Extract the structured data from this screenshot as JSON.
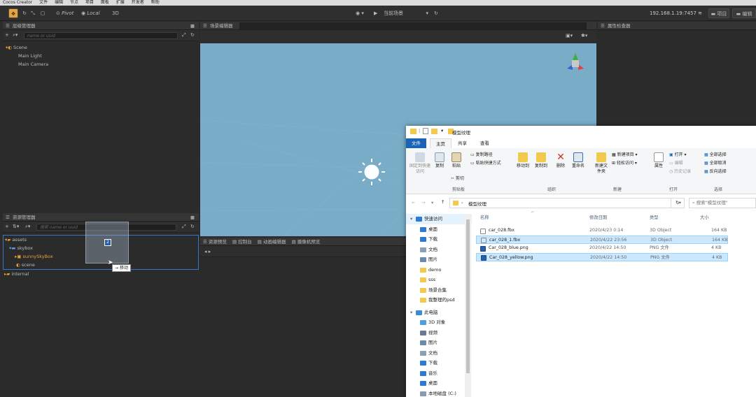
{
  "app": {
    "title": "Cocos Creator",
    "menu": [
      "文件",
      "编辑",
      "节点",
      "项目",
      "面板",
      "扩展",
      "开发者",
      "帮助"
    ]
  },
  "toolbar": {
    "pivot_label": "Pivot",
    "local_label": "Local",
    "mode_3d": "3D",
    "scene_select": "当前场景",
    "ip": "192.168.1.19:7457",
    "project_btn": "项目",
    "editor_btn": "编辑"
  },
  "hierarchy": {
    "title": "层级管理器",
    "search_placeholder": "name or uuid",
    "nodes": [
      "Scene",
      "Main Light",
      "Main Camera"
    ]
  },
  "scene_editor": {
    "title": "场景编辑器"
  },
  "inspector": {
    "title": "属性检查器"
  },
  "assets": {
    "title": "资源管理器",
    "search_placeholder": "搜索 name or uuid",
    "items": [
      "assets",
      "skybox",
      "sunnySkyBox",
      "scene",
      "internal"
    ],
    "drag_count": "2",
    "drag_tooltip": "移动"
  },
  "bottom_tabs": [
    "资源预览",
    "控制台",
    "动画编辑器",
    "摄像机预览"
  ],
  "explorer": {
    "title": "模型纹理",
    "ribbon_tabs": [
      "文件",
      "主页",
      "共享",
      "查看"
    ],
    "clipboard": {
      "pin": "固定到快速访问",
      "copy": "复制",
      "paste": "粘贴",
      "copy_path": "复制路径",
      "paste_shortcut": "粘贴快捷方式",
      "cut": "剪切",
      "group": "剪贴板"
    },
    "organize": {
      "move_to": "移动到",
      "copy_to": "复制到",
      "delete": "删除",
      "rename": "重命名",
      "group": "组织"
    },
    "new": {
      "new_folder": "新建文件夹",
      "new_item": "新建项目",
      "easy_access": "轻松访问",
      "group": "新建"
    },
    "open": {
      "properties": "属性",
      "open": "打开",
      "edit": "编辑",
      "history": "历史记录",
      "group": "打开"
    },
    "select": {
      "select_all": "全部选择",
      "select_none": "全部取消",
      "invert": "反向选择",
      "group": "选择"
    },
    "address": "模型纹理",
    "search_placeholder": "搜索\"模型纹理\"",
    "columns": [
      "名称",
      "修改日期",
      "类型",
      "大小"
    ],
    "files": [
      {
        "name": "car_028.fbx",
        "date": "2020/4/23 0:14",
        "type": "3D Object",
        "size": "164 KB",
        "selected": false
      },
      {
        "name": "car_028_1.fbx",
        "date": "2020/4/22 23:56",
        "type": "3D Object",
        "size": "164 KB",
        "selected": true
      },
      {
        "name": "Car_028_blue.png",
        "date": "2020/4/22 14:50",
        "type": "PNG 文件",
        "size": "4 KB",
        "selected": false
      },
      {
        "name": "Car_028_yellow.png",
        "date": "2020/4/22 14:50",
        "type": "PNG 文件",
        "size": "4 KB",
        "selected": true
      }
    ],
    "nav": [
      "快速访问",
      "桌面",
      "下载",
      "文档",
      "图片",
      "demo",
      "sss",
      "场景合集",
      "我整理的psd",
      "此电脑",
      "3D 对象",
      "视频",
      "图片",
      "文档",
      "下载",
      "音乐",
      "桌面",
      "本地磁盘 (C:)"
    ]
  },
  "colors": {
    "scene_bg": "#79acc7",
    "panel_bg": "#2b2b2b",
    "accent_orange": "#e8a33a",
    "ribbon_file_blue": "#1a63b6"
  }
}
